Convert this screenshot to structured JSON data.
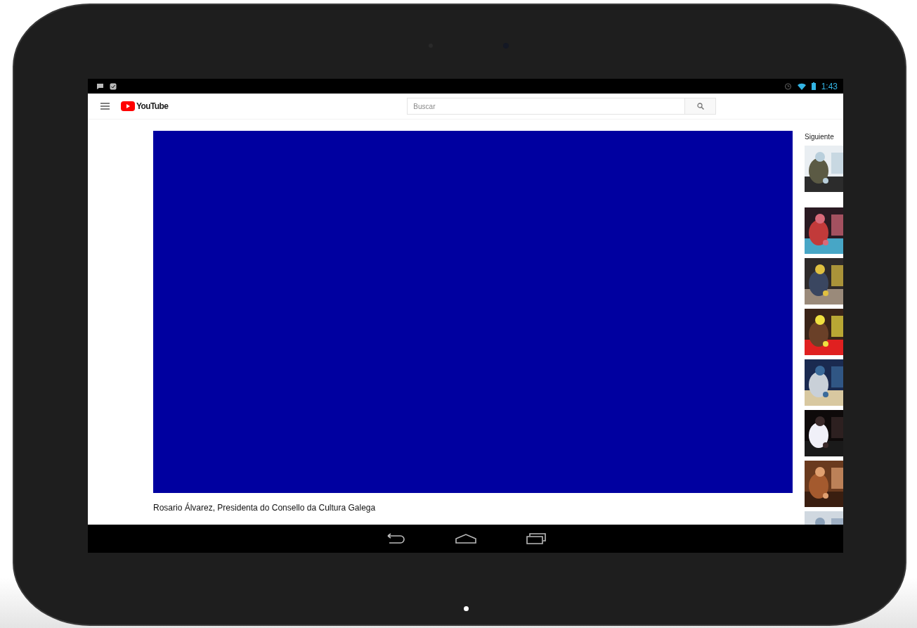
{
  "status_bar": {
    "time": "1:43"
  },
  "header": {
    "logo": "YouTube",
    "search": {
      "placeholder": "Buscar"
    }
  },
  "video": {
    "title": "Rosario Álvarez, Presidenta do Consello da Cultura Galega"
  },
  "sidebar": {
    "label": "Siguiente"
  }
}
